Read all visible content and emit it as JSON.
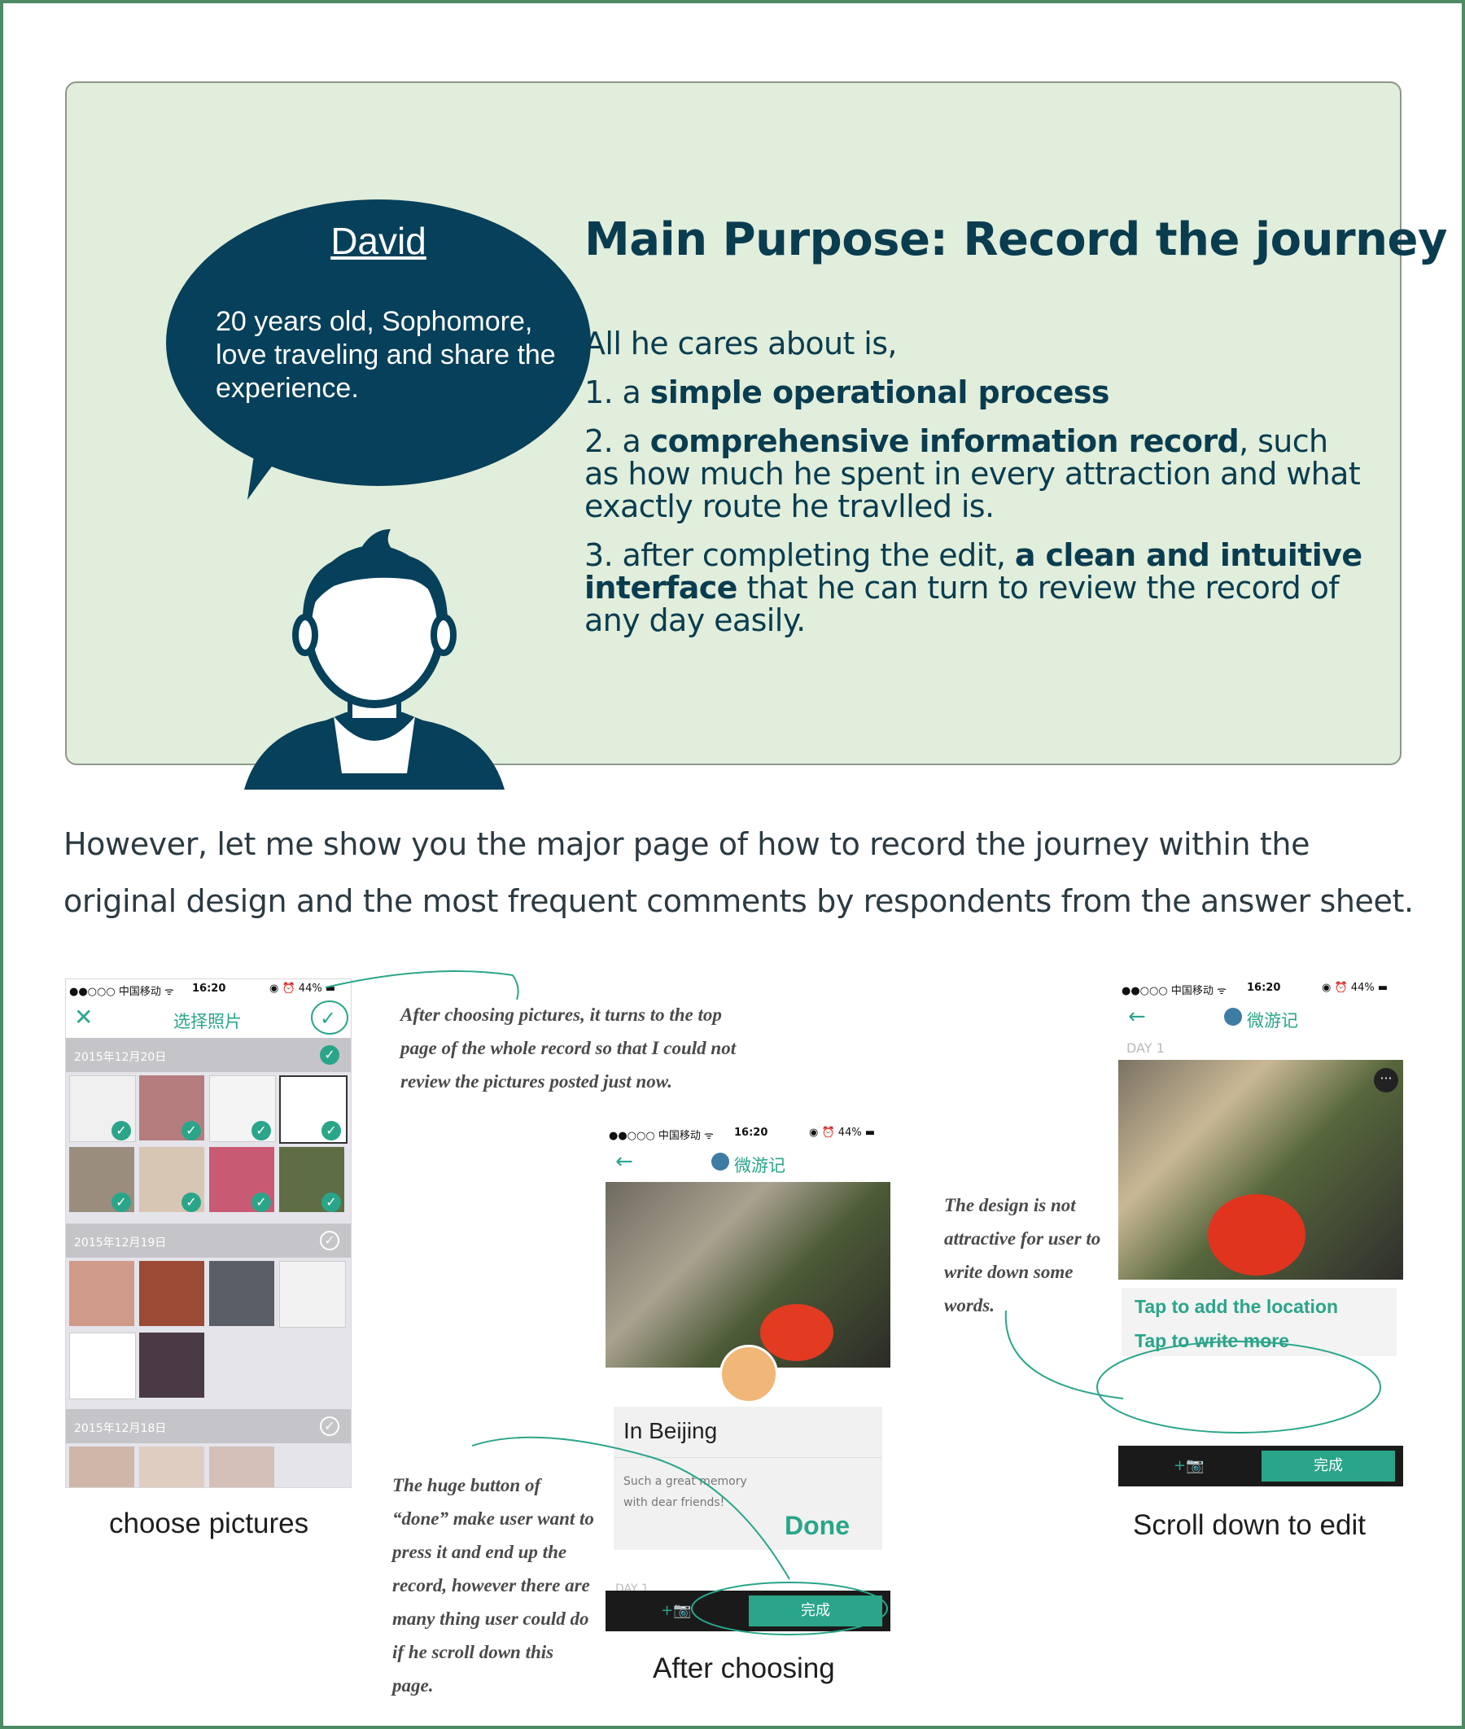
{
  "persona": {
    "name": "David",
    "bio": "20 years old, Sophomore, love traveling and share the experience.",
    "main_purpose": "Main Purpose: Record the journey",
    "intro_line": "All he cares about is,",
    "item1_prefix": "1.  a ",
    "item1_bold": "simple operational process",
    "item2_prefix": "2.  a ",
    "item2_bold": "comprehensive information record",
    "item2_rest": ", such as how much he spent in every attraction and what exactly route he travlled is.",
    "item3_prefix": "3.  after completing the edit, ",
    "item3_bold": "a clean and intuitive interface",
    "item3_rest": " that he can turn to review the record of any day easily."
  },
  "intro_paragraph": "However, let me show you the major page of how to record the journey within the original design and the most frequent comments by respondents from the answer sheet.",
  "status_bar": {
    "carrier": "●●○○○ 中国移动 ᯤ",
    "time": "16:20",
    "battery": "◉ ⏰ 44% ▬"
  },
  "screen1": {
    "title": "选择照片",
    "dates": [
      "2015年12月20日",
      "2015年12月19日",
      "2015年12月18日"
    ],
    "caption": "choose pictures"
  },
  "screen2": {
    "title": "微游记",
    "location": "In Beijing",
    "memory_line1": "Such a great memory",
    "memory_line2": "with dear friends!",
    "done_annotation": "Done",
    "day_label": "DAY 1",
    "camera_label": "+📷",
    "done_button": "完成",
    "caption": "After choosing"
  },
  "screen3": {
    "title": "微游记",
    "day_label": "DAY 1",
    "tap_location": "Tap to add the location",
    "tap_write": "Tap to write more",
    "camera_label": "+📷",
    "done_button": "完成",
    "caption": "Scroll down to edit"
  },
  "notes": {
    "top": "After choosing pictures, it turns to the top page of the whole record so that  I could not review the pictures posted just now.",
    "middle": "The design is not attractive for user to write down some words.",
    "bottom": "The huge button of “done” make user want to press it and end up the record, however there are many thing user could do if he scroll down this page."
  },
  "colors": {
    "accent": "#2aa58a",
    "navy": "#06405a",
    "card": "#e1eedb",
    "frame": "#4e8a63"
  }
}
